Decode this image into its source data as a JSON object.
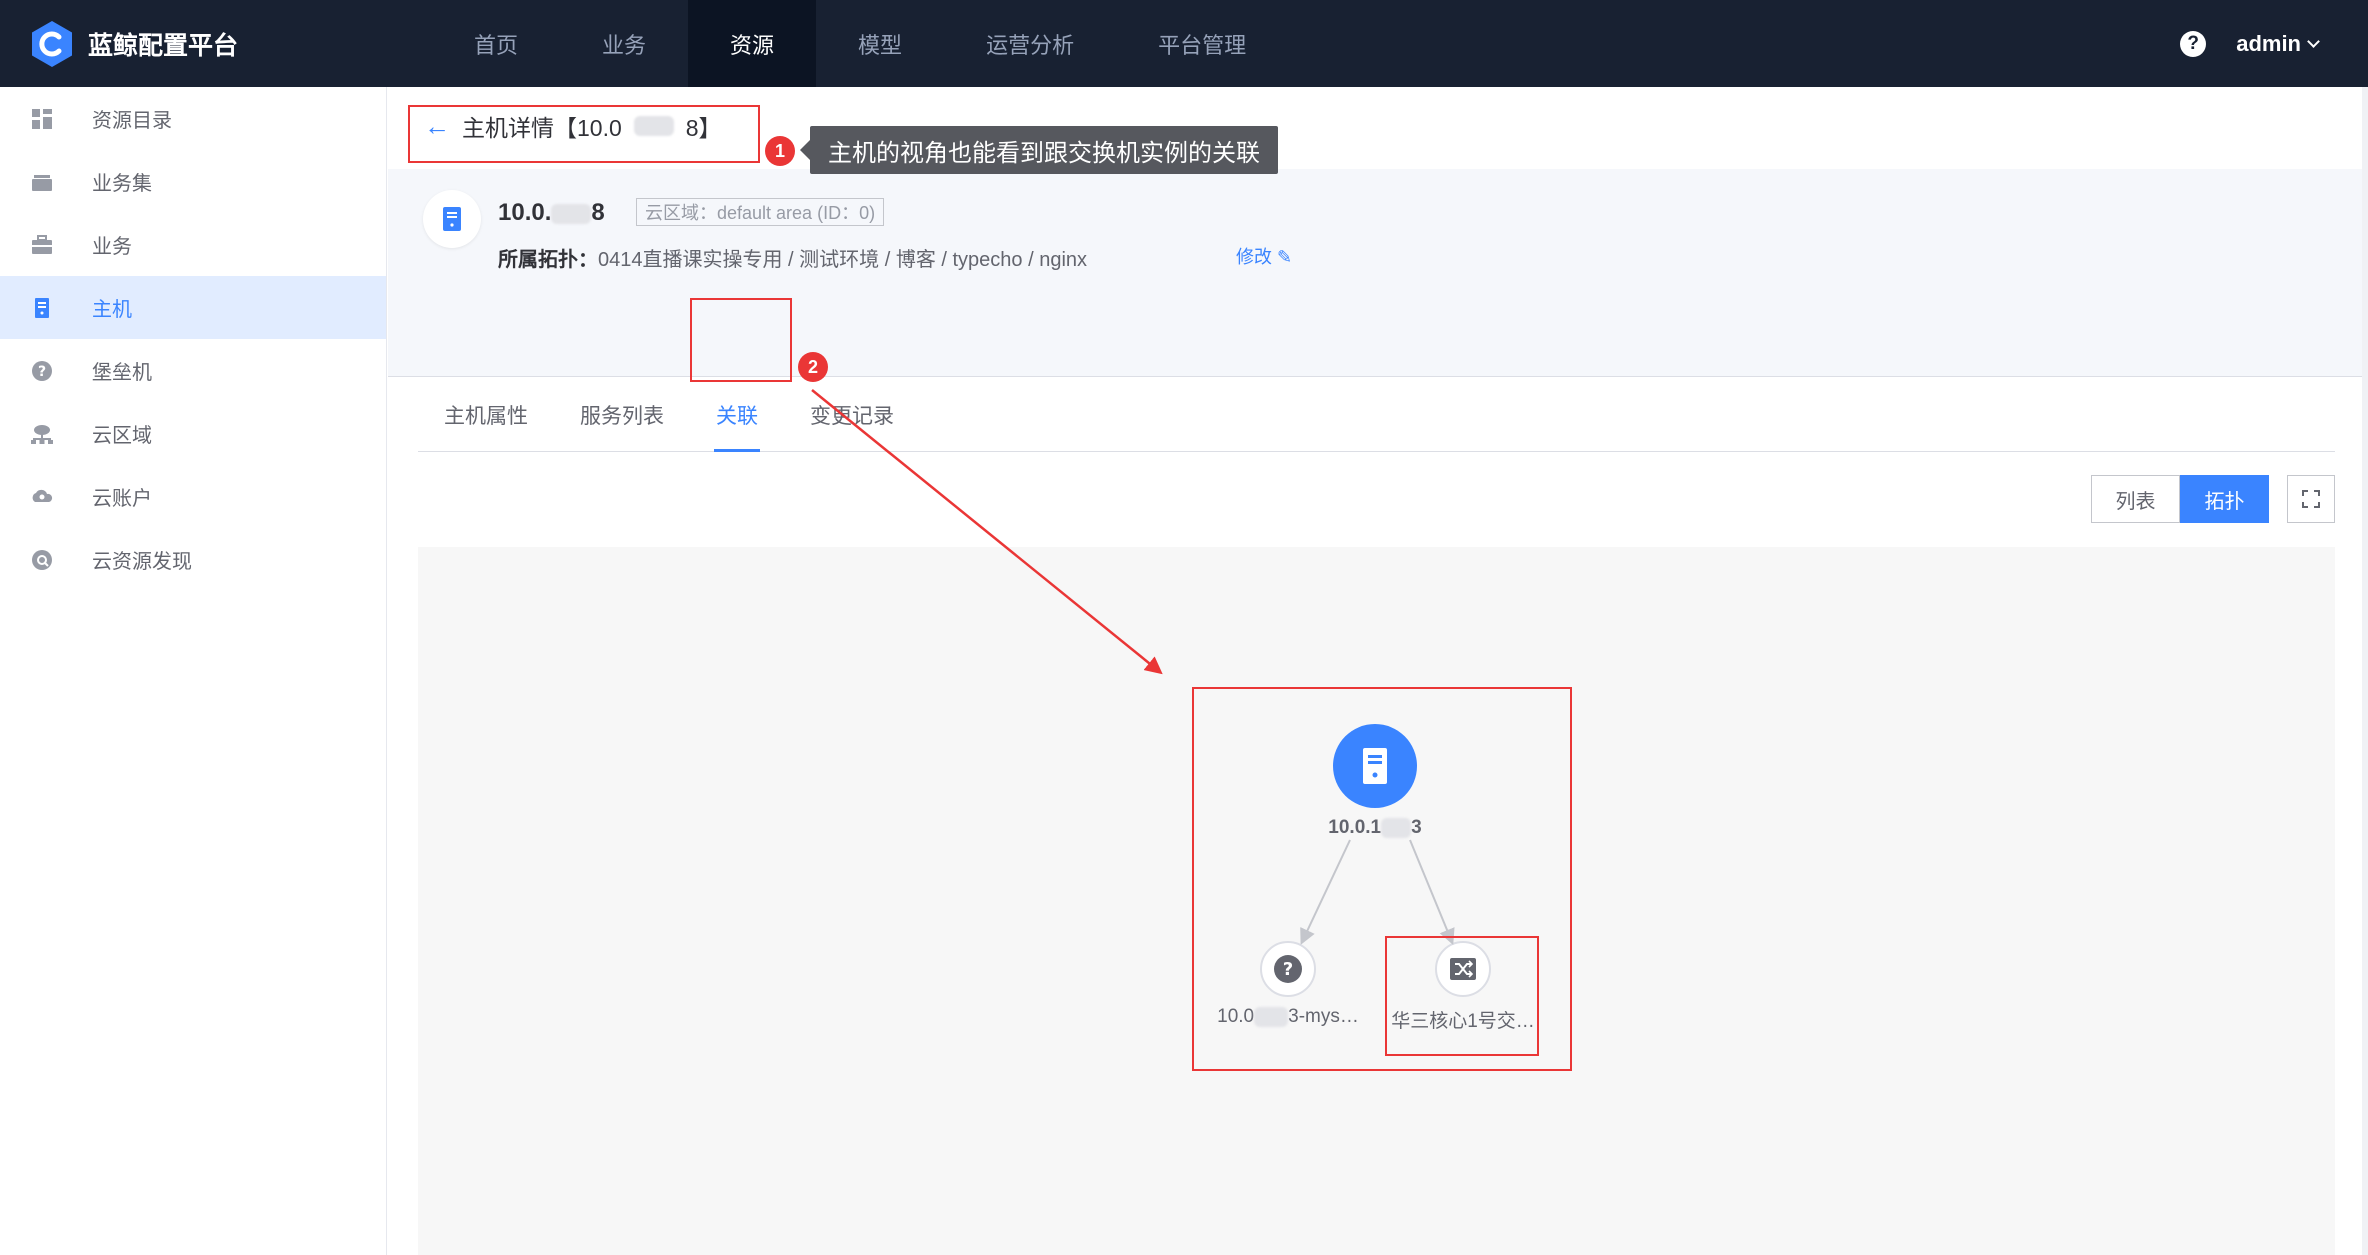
{
  "app": {
    "title": "蓝鲸配置平台"
  },
  "nav": [
    {
      "label": "首页",
      "active": false
    },
    {
      "label": "业务",
      "active": false
    },
    {
      "label": "资源",
      "active": true
    },
    {
      "label": "模型",
      "active": false
    },
    {
      "label": "运营分析",
      "active": false
    },
    {
      "label": "平台管理",
      "active": false
    }
  ],
  "user": {
    "name": "admin"
  },
  "sidebar": {
    "items": [
      {
        "label": "资源目录",
        "icon": "grid-icon"
      },
      {
        "label": "业务集",
        "icon": "briefcase-stack-icon"
      },
      {
        "label": "业务",
        "icon": "briefcase-icon"
      },
      {
        "label": "主机",
        "icon": "host-icon",
        "active": true
      },
      {
        "label": "堡垒机",
        "icon": "question-circle-icon"
      },
      {
        "label": "云区域",
        "icon": "cloud-network-icon"
      },
      {
        "label": "云账户",
        "icon": "cloud-account-icon"
      },
      {
        "label": "云资源发现",
        "icon": "discover-icon"
      }
    ]
  },
  "page": {
    "title_prefix": "主机详情【10.0",
    "title_suffix": "8】"
  },
  "host": {
    "ip_prefix": "10.0.",
    "ip_suffix": "8",
    "cloud_area": "云区域：default area (ID：0)",
    "topo_label": "所属拓扑：",
    "topo_path": "0414直播课实操专用 / 测试环境 / 博客 / typecho / nginx",
    "edit_label": "修改"
  },
  "tabs": [
    {
      "label": "主机属性",
      "active": false
    },
    {
      "label": "服务列表",
      "active": false
    },
    {
      "label": "关联",
      "active": true
    },
    {
      "label": "变更记录",
      "active": false
    }
  ],
  "view_toggle": {
    "list_label": "列表",
    "topo_label": "拓扑",
    "active": "topo"
  },
  "annotations": {
    "badge1": "1",
    "badge2": "2",
    "tooltip": "主机的视角也能看到跟交换机实例的关联"
  },
  "topology": {
    "root": {
      "label_prefix": "10.0.1",
      "label_suffix": "3",
      "icon": "host-icon"
    },
    "children": [
      {
        "label_prefix": "10.0",
        "label_suffix": "3-mys…",
        "icon": "question-circle-icon"
      },
      {
        "label": "华三核心1号交…",
        "icon": "switch-icon"
      }
    ]
  },
  "colors": {
    "accent": "#3a84ff",
    "annotation": "#ea3636",
    "topbar": "#182132"
  }
}
